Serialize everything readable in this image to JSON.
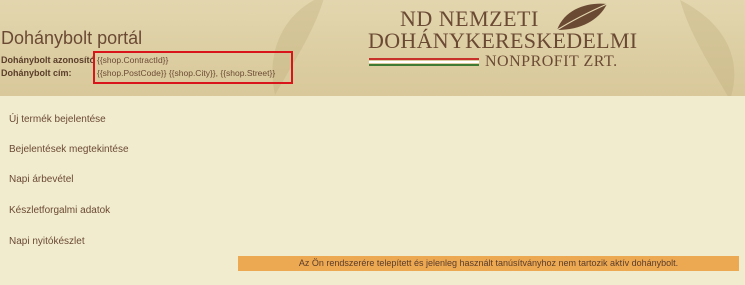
{
  "portal": {
    "title": "Dohánybolt portál"
  },
  "shop_info": {
    "id_label": "Dohánybolt azonosító",
    "id_value": "{{shop.ContractId}}",
    "address_label": "Dohánybolt cím:",
    "address_value": "{{shop.PostCode}} {{shop.City}}, {{shop.Street}}"
  },
  "logo": {
    "line1": "ND NEMZETI",
    "line2": "DOHÁNYKERESKEDELMI",
    "line3": "NONPROFIT ZRT.",
    "icon": "tobacco-leaf-icon"
  },
  "menu": [
    {
      "label": "Új termék bejelentése"
    },
    {
      "label": "Bejelentések megtekintése"
    },
    {
      "label": "Napi árbevétel"
    },
    {
      "label": "Készletforgalmi adatok"
    },
    {
      "label": "Napi nyitókészlet"
    }
  ],
  "notice": {
    "text": "Az Ön rendszerére telepített és jelenleg használt tanúsítványhoz nem tartozik aktív dohánybolt."
  },
  "colors": {
    "brand_brown": "#6b4a34",
    "header_bg": "#d8c89a",
    "page_bg": "#f2ecce",
    "highlight_red": "#d9141a",
    "notice_bg": "#eda852",
    "flag_red": "#c8312a",
    "flag_green": "#3f7a35"
  }
}
